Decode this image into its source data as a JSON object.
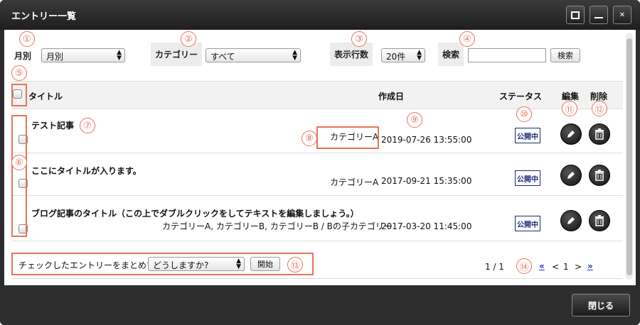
{
  "window": {
    "title": "エントリー一覧",
    "close_label": "閉じる"
  },
  "filters": {
    "month_label": "月別",
    "month_value": "月別",
    "category_label": "カテゴリー",
    "category_value": "すべて",
    "rows_label": "表示行数",
    "rows_value": "20件",
    "search_label": "検索",
    "search_value": "",
    "search_button": "検索"
  },
  "table": {
    "columns": {
      "title": "タイトル",
      "date": "作成日",
      "status": "ステータス",
      "edit": "編集",
      "delete": "削除"
    },
    "rows": [
      {
        "title": "テスト記事",
        "category": "カテゴリーA",
        "date": "2019-07-26 13:55:00",
        "status": "公開中"
      },
      {
        "title": "ここにタイトルが入ります。",
        "category": "カテゴリーA",
        "date": "2017-09-21 15:35:00",
        "status": "公開中"
      },
      {
        "title": "ブログ記事のタイトル（この上でダブルクリックをしてテキストを編集しましょう。）",
        "category": "カテゴリーA, カテゴリーB, カテゴリーB / Bの子カテゴリー",
        "date": "2017-03-20 11:45:00",
        "status": "公開中"
      }
    ]
  },
  "bulk": {
    "label": "チェックしたエントリーをまとめて",
    "select_value": "どうしますか?",
    "start_button": "開始"
  },
  "pager": {
    "info": "1 / 1",
    "first": "«",
    "prev": "<",
    "current": "1",
    "next": ">",
    "last": "»"
  },
  "annotations": [
    "①",
    "②",
    "③",
    "④",
    "⑤",
    "⑥",
    "⑦",
    "⑧",
    "⑨",
    "⑩",
    "⑪",
    "⑫",
    "⑬",
    "⑭"
  ],
  "colors": {
    "annotation": "#e8735a",
    "status_badge": "#1e2a78",
    "link": "#1a2bd6",
    "window_chrome": "#2b2b2b"
  }
}
